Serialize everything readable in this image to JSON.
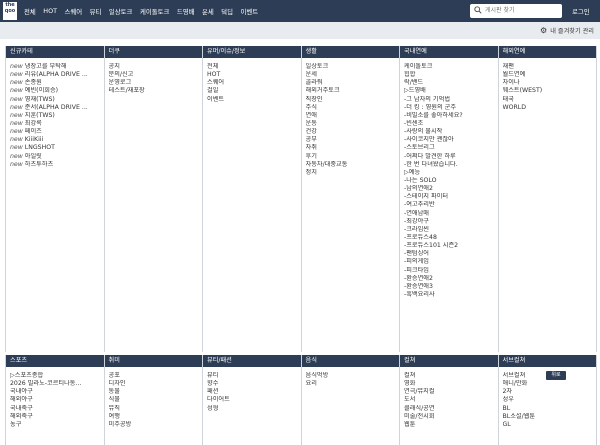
{
  "logo": "the\nqoo",
  "nav": [
    "전체",
    "HOT",
    "스퀘어",
    "뷰티",
    "일상토크",
    "케이돌토크",
    "드영배",
    "운세",
    "덬딥",
    "이벤트"
  ],
  "search": {
    "placeholder": "게시판 찾기"
  },
  "login": "로그인",
  "favorites_manage": "내 즐겨찾기 관리",
  "top_button": "위로",
  "sections": [
    {
      "title": "신규카테",
      "items": [
        {
          "prefix": "new",
          "label": "냉장고를 부탁해"
        },
        {
          "prefix": "new",
          "label": "리유(ALPHA DRIVE ..."
        },
        {
          "prefix": "new",
          "label": "손종원"
        },
        {
          "prefix": "new",
          "label": "예빈(이희승)"
        },
        {
          "prefix": "new",
          "label": "영재(TWS)"
        },
        {
          "prefix": "new",
          "label": "준서(ALPHA DRIVE ..."
        },
        {
          "prefix": "new",
          "label": "지훈(TWS)"
        },
        {
          "prefix": "new",
          "label": "최강록"
        },
        {
          "prefix": "new",
          "label": "페이즈"
        },
        {
          "prefix": "new",
          "label": "KiiiKiii"
        },
        {
          "prefix": "new",
          "label": "LNGSHOT"
        },
        {
          "prefix": "new",
          "label": "아일릿"
        },
        {
          "prefix": "new",
          "label": "하츠투하츠"
        }
      ]
    },
    {
      "title": "더쿠",
      "items": [
        {
          "label": "공지"
        },
        {
          "label": "문의/신고"
        },
        {
          "label": "운영로그"
        },
        {
          "label": "테스트/재포장"
        }
      ]
    },
    {
      "title": "유머/이슈/정보",
      "items": [
        {
          "label": "전체"
        },
        {
          "label": "HOT"
        },
        {
          "label": "스퀘어"
        },
        {
          "label": "걸일"
        },
        {
          "label": "이벤트"
        }
      ]
    },
    {
      "title": "생활",
      "items": [
        {
          "label": "일상토크"
        },
        {
          "label": "운세"
        },
        {
          "label": "골라줘"
        },
        {
          "label": "해외거주토크"
        },
        {
          "label": "직장인"
        },
        {
          "label": "주식"
        },
        {
          "label": "연애"
        },
        {
          "label": "운동"
        },
        {
          "label": "건강"
        },
        {
          "label": "공부"
        },
        {
          "label": "자취"
        },
        {
          "label": "후기"
        },
        {
          "label": "자동차/대중교통"
        },
        {
          "label": "정치"
        }
      ]
    },
    {
      "title": "국내연예",
      "items": [
        {
          "label": "케이돌토크"
        },
        {
          "label": "힙합"
        },
        {
          "label": "락/밴드"
        },
        {
          "label": "▷드영배"
        },
        {
          "label": "-그 남자의 기억법"
        },
        {
          "label": "-더 킹 : 영원의 군주"
        },
        {
          "label": "-비밀소를 좋아하세요?"
        },
        {
          "label": "-빈센조"
        },
        {
          "label": "-사랑의 불시착"
        },
        {
          "label": "-사이코지만 괜찮아"
        },
        {
          "label": "-스토브리그"
        },
        {
          "label": "-어쩌다 발견한 하루"
        },
        {
          "label": "-한 번 다녀왔습니다."
        },
        {
          "label": "▷예능"
        },
        {
          "label": "-나는 SOLO"
        },
        {
          "label": "-남의연애2"
        },
        {
          "label": "-스테이지 파이터"
        },
        {
          "label": "-여고추리반"
        },
        {
          "label": "-연애남매"
        },
        {
          "label": "-최강야구"
        },
        {
          "label": "-크라임씬"
        },
        {
          "label": "-프로듀스48"
        },
        {
          "label": "-프로듀스101 시즌2"
        },
        {
          "label": "-팬텀싱어"
        },
        {
          "label": "-피의게임"
        },
        {
          "label": "-피크타임"
        },
        {
          "label": "-환승연애2"
        },
        {
          "label": "-환승연애3"
        },
        {
          "label": "-흑백요리사"
        }
      ]
    },
    {
      "title": "해외연예",
      "items": [
        {
          "label": "재팬"
        },
        {
          "label": "월드연예"
        },
        {
          "label": "차이나"
        },
        {
          "label": "웨스트(WEST)"
        },
        {
          "label": "태국"
        },
        {
          "label": "WORLD"
        }
      ]
    },
    {
      "title": "스포츠",
      "items": [
        {
          "label": "▷스포츠종합"
        },
        {
          "label": "2026 밀라노-코르티나동..."
        },
        {
          "label": "국내야구"
        },
        {
          "label": "해외야구"
        },
        {
          "label": "국내축구"
        },
        {
          "label": "해외축구"
        },
        {
          "label": "농구"
        }
      ]
    },
    {
      "title": "취미",
      "items": [
        {
          "label": "공포"
        },
        {
          "label": "디자인"
        },
        {
          "label": "동물"
        },
        {
          "label": "식물"
        },
        {
          "label": "뮤직"
        },
        {
          "label": "여행"
        },
        {
          "label": "미주공방"
        }
      ]
    },
    {
      "title": "뷰티/패션",
      "items": [
        {
          "label": "뷰티"
        },
        {
          "label": "향수"
        },
        {
          "label": "패션"
        },
        {
          "label": "다이어트"
        },
        {
          "label": "성형"
        }
      ]
    },
    {
      "title": "음식",
      "items": [
        {
          "label": "음식먹방"
        },
        {
          "label": "요리"
        }
      ]
    },
    {
      "title": "컬쳐",
      "items": [
        {
          "label": "컬쳐"
        },
        {
          "label": "영화"
        },
        {
          "label": "연극/뮤지컬"
        },
        {
          "label": "도서"
        },
        {
          "label": "클래식/공연"
        },
        {
          "label": "미술/전시회"
        },
        {
          "label": "웹툰"
        }
      ]
    },
    {
      "title": "서브컬쳐",
      "items": [
        {
          "label": "서브컬쳐"
        },
        {
          "label": "애니/만화"
        },
        {
          "label": "2차"
        },
        {
          "label": "성우"
        },
        {
          "label": "BL"
        },
        {
          "label": "BL소설/웹툰"
        },
        {
          "label": "GL"
        }
      ]
    }
  ]
}
